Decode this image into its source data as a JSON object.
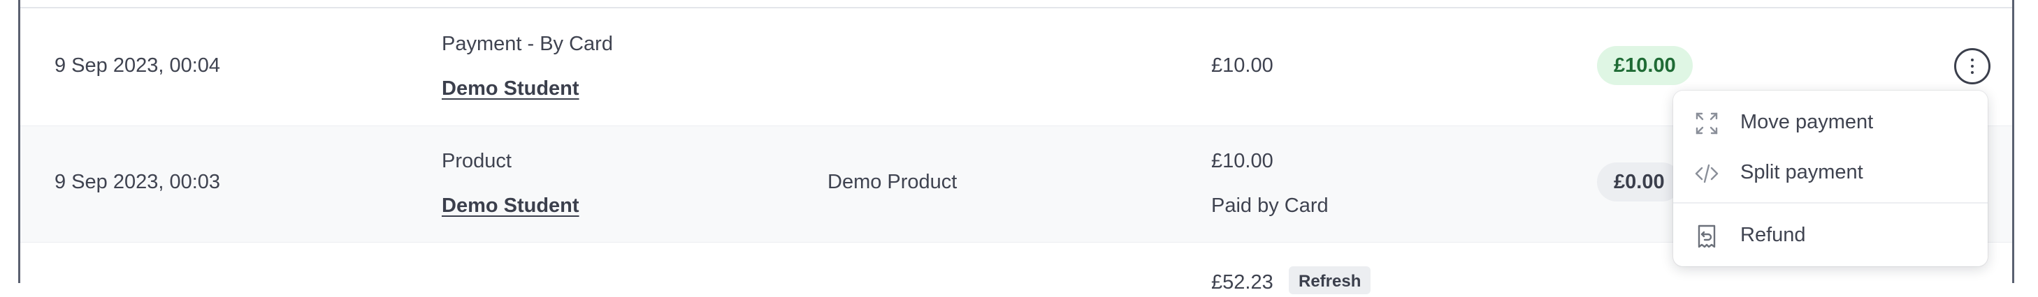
{
  "rows": [
    {
      "date": "9 Sep 2023, 00:04",
      "type": "Payment - By Card",
      "student": "Demo Student",
      "product": "",
      "amount": "£10.00",
      "amount_note": "",
      "balance": "£10.00",
      "balance_status": "positive"
    },
    {
      "date": "9 Sep 2023, 00:03",
      "type": "Product",
      "student": "Demo Student",
      "product": "Demo Product",
      "amount": "£10.00",
      "amount_note": "Paid by Card",
      "balance": "£0.00",
      "balance_status": "neutral"
    },
    {
      "date": "",
      "type": "",
      "student": "",
      "product": "",
      "amount": "£52.23",
      "refresh_label": "Refresh",
      "balance": ""
    }
  ],
  "actions_menu": {
    "items": [
      {
        "label": "Move payment",
        "icon": "move-icon"
      },
      {
        "label": "Split payment",
        "icon": "code-icon"
      },
      {
        "label": "Refund",
        "icon": "refund-icon"
      }
    ]
  },
  "colors": {
    "badge_green_bg": "#dff6e4",
    "badge_green_text": "#1f6b35",
    "badge_gray_bg": "#eceef1",
    "text": "#3f4350",
    "frame_border": "#5a6070"
  }
}
